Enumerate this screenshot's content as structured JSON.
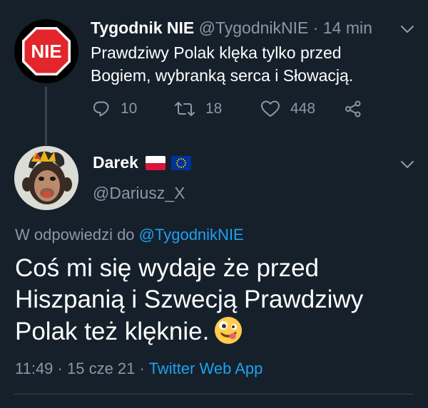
{
  "parent_tweet": {
    "author_name": "Tygodnik NIE",
    "handle": "@TygodnikNIE",
    "separator": "·",
    "time": "14 min",
    "avatar_text": "NIE",
    "text_line1": "Prawdziwy Polak klęka tylko przed",
    "text_line2": "Bogiem, wybranką serca i Słowacją.",
    "replies": "10",
    "retweets": "18",
    "likes": "448"
  },
  "reply_tweet": {
    "author_name": "Darek",
    "flags": [
      "flag-poland-icon",
      "flag-eu-icon"
    ],
    "handle": "@Dariusz_X",
    "reply_prefix": "W odpowiedzi do",
    "reply_to": "@TygodnikNIE",
    "text_line1": "Coś mi się wydaje że przed",
    "text_line2": "Hiszpanią i Szwecją Prawdziwy",
    "text_line3": "Polak też klęknie.",
    "time": "11:49",
    "date": "15 cze 21",
    "separator": "·",
    "source": "Twitter Web App"
  },
  "colors": {
    "background": "#15202b",
    "muted": "#8899a6",
    "link": "#1da1f2",
    "divider": "#38444d"
  }
}
